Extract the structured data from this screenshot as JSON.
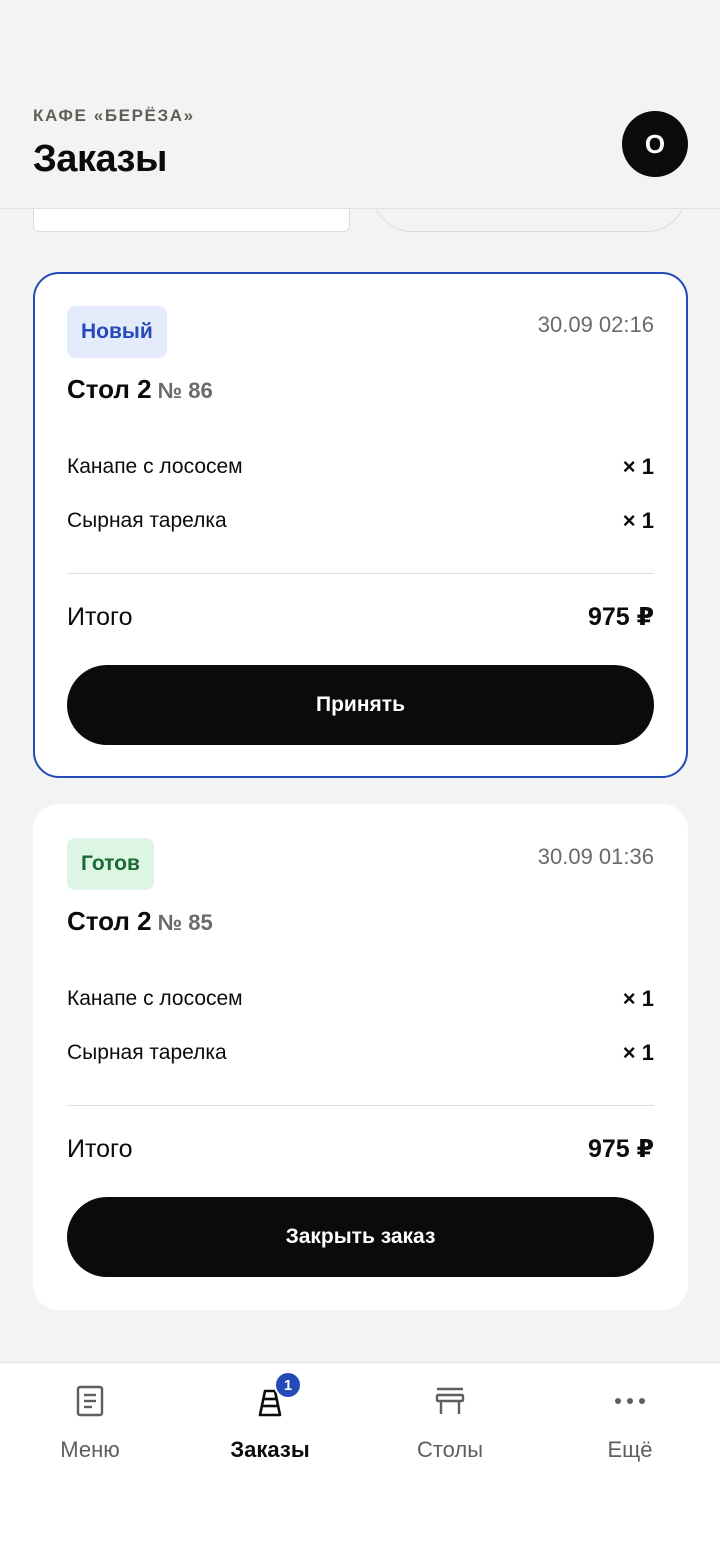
{
  "header": {
    "cafe_name": "КАФЕ «БЕРЁЗА»",
    "title": "Заказы",
    "avatar_initial": "О"
  },
  "orders": [
    {
      "status": "Новый",
      "status_color": "#2449b8",
      "time": "30.09 02:16",
      "table": "Стол 2",
      "number": "№ 86",
      "items": [
        {
          "name": "Канапе с лососем",
          "qty": "× 1"
        },
        {
          "name": "Сырная тарелка",
          "qty": "× 1"
        }
      ],
      "total_label": "Итого",
      "total": "975 ₽",
      "action": "Принять"
    },
    {
      "status": "Готов",
      "status_color": "#1b6a35",
      "time": "30.09 01:36",
      "table": "Стол 2",
      "number": "№ 85",
      "items": [
        {
          "name": "Канапе с лососем",
          "qty": "× 1"
        },
        {
          "name": "Сырная тарелка",
          "qty": "× 1"
        }
      ],
      "total_label": "Итого",
      "total": "975 ₽",
      "action": "Закрыть заказ"
    }
  ],
  "nav": {
    "items": [
      {
        "label": "Меню",
        "icon": "menu-document-icon"
      },
      {
        "label": "Заказы",
        "icon": "orders-bag-icon",
        "badge": "1",
        "active": true
      },
      {
        "label": "Столы",
        "icon": "table-icon"
      },
      {
        "label": "Ещё",
        "icon": "more-dots-icon"
      }
    ]
  },
  "colors": {
    "accent": "#2449b8",
    "background": "#f3f3f1",
    "button": "#0b0b0b"
  }
}
